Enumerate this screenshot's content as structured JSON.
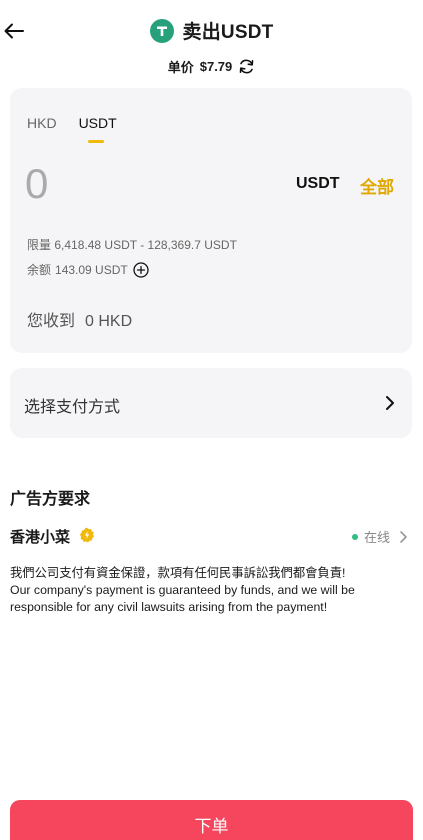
{
  "header": {
    "title": "卖出USDT",
    "price_label": "单价",
    "price_value": "$7.79"
  },
  "amount_card": {
    "tabs": [
      {
        "label": "HKD",
        "active": false
      },
      {
        "label": "USDT",
        "active": true
      }
    ],
    "amount": "0",
    "unit": "USDT",
    "all_label": "全部",
    "limit_label": "限量",
    "limit_value": "6,418.48 USDT - 128,369.7 USDT",
    "balance_label": "余额",
    "balance_value": "143.09 USDT",
    "receive_label": "您收到",
    "receive_value": "0 HKD"
  },
  "payment": {
    "label": "选择支付方式"
  },
  "advertiser": {
    "section_title": "广告方要求",
    "name": "香港小菜",
    "status": "在线",
    "remarks": [
      "我們公司支付有資金保證，款項有任何民事訴訟我們都會負責!",
      "Our company's payment is guaranteed by funds, and we will be responsible for any civil lawsuits arising from the payment!"
    ]
  },
  "footer": {
    "order_label": "下单"
  },
  "colors": {
    "accent_yellow": "#f0b90b",
    "all_text": "#e0a800",
    "tether_green": "#26a17b",
    "online_green": "#2ebd85",
    "order_red": "#f6465d",
    "card_bg": "#f5f5f7"
  },
  "icons": {
    "back": "arrow-left-icon",
    "coin": "tether-icon",
    "refresh": "refresh-icon",
    "add": "plus-circle-icon",
    "chevron": "chevron-right-icon",
    "verified": "verified-badge-icon"
  }
}
